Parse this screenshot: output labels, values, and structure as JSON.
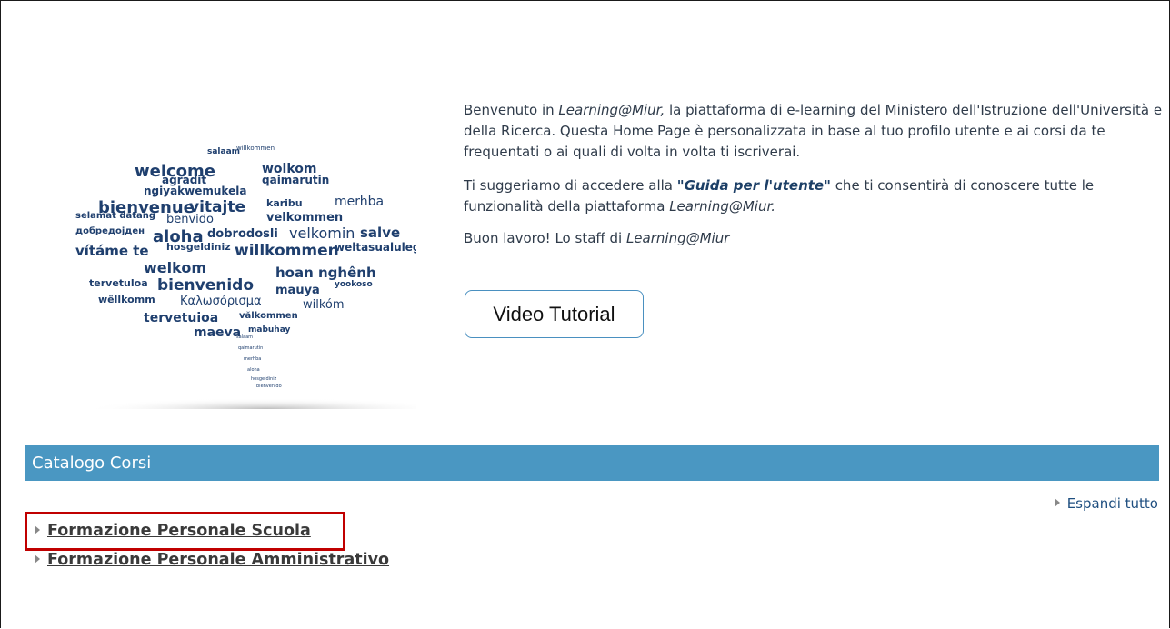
{
  "intro": {
    "p1_a": "Benvenuto in ",
    "p1_em": "Learning@Miur,",
    "p1_b": " la piattaforma di e-learning del Ministero dell'Istruzione dell'Università e della Ricerca.  Questa Home Page è personalizzata in base al tuo profilo utente e ai corsi da te frequentati o ai quali di volta in volta ti iscriverai.",
    "p2_a": "Ti suggeriamo di accedere alla ",
    "p2_guide": "\"Guida per l'utente\"",
    "p2_b": " che ti consentirà di conoscere tutte le funzionalità della piattaforma ",
    "p2_em": "Learning@Miur.",
    "p3_a": "Buon lavoro!  Lo staff di ",
    "p3_em": "Learning@Miur"
  },
  "video_button": "Video Tutorial",
  "catalog": {
    "title": "Catalogo Corsi",
    "expand_all": "Espandi tutto",
    "courses": [
      {
        "label": "Formazione Personale Scuola"
      },
      {
        "label": "Formazione Personale Amministrativo"
      }
    ]
  },
  "word_cloud": {
    "words": [
      "salaam",
      "willkommen",
      "welcome",
      "wolkom",
      "agradit",
      "qaimarutin",
      "ngiyakwemukela",
      "bienvenue",
      "vitajte",
      "karibu",
      "merhba",
      "selamat datang",
      "benvido",
      "velkommen",
      "добредојден",
      "aloha",
      "dobrodosli",
      "velkomin",
      "salve",
      "vítáme te",
      "hosgeldiniz",
      "willkommen",
      "weltasualuleg",
      "welkom",
      "hoan nghênh",
      "bienvenido",
      "tervetuloa",
      "mauya",
      "yookoso",
      "wëllkomm",
      "Καλωσόρισμα",
      "wilkóm",
      "tervetuioa",
      "vălkommen",
      "maeva",
      "mabuhay"
    ]
  },
  "colors": {
    "accent": "#4a97c2",
    "highlight": "#c00000",
    "cloud": "#1f3f6e"
  }
}
